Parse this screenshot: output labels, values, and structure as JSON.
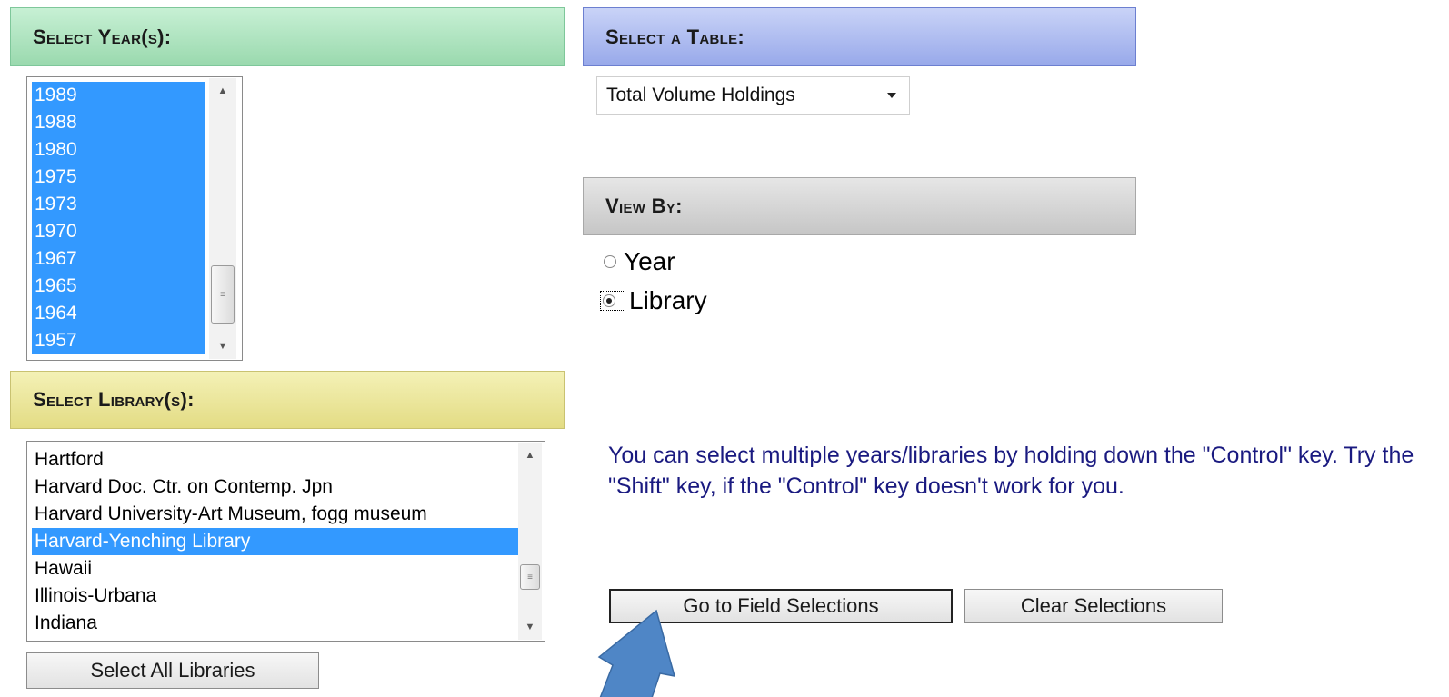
{
  "headers": {
    "years": "Select Year(s):",
    "table": "Select a Table:",
    "view_by": "View By:",
    "libraries": "Select Library(s):"
  },
  "years": [
    "1989",
    "1988",
    "1980",
    "1975",
    "1973",
    "1970",
    "1967",
    "1965",
    "1964",
    "1957"
  ],
  "table_select": {
    "value": "Total Volume Holdings"
  },
  "view_by": {
    "options": [
      "Year",
      "Library"
    ],
    "selected": "Library"
  },
  "libraries": {
    "items": [
      "Hartford",
      "Harvard Doc. Ctr. on Contemp. Jpn",
      "Harvard University-Art Museum, fogg museum",
      "Harvard-Yenching Library",
      "Hawaii",
      "Illinois-Urbana",
      "Indiana"
    ],
    "selected": "Harvard-Yenching Library"
  },
  "buttons": {
    "select_all": "Select All Libraries",
    "go": "Go to Field Selections",
    "clear": "Clear Selections"
  },
  "note": "You can select multiple years/libraries by holding down the \"Control\" key. Try the \"Shift\" key, if the \"Control\" key doesn't work for you.",
  "colors": {
    "selection": "#3399ff",
    "note_text": "#1a1a80",
    "arrow": "#4f86c6"
  }
}
